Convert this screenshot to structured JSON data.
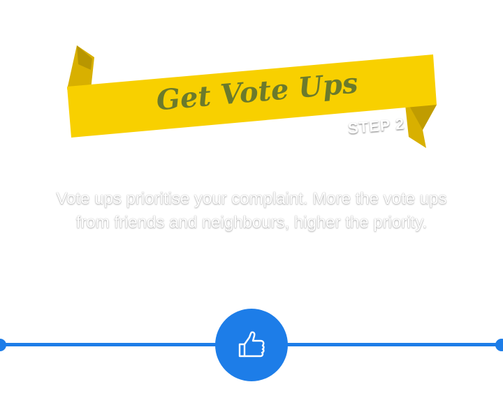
{
  "banner": {
    "title": "Get Vote Ups",
    "step": "STEP 2"
  },
  "description": "Vote ups prioritise your complaint. More the vote ups from friends and neighbours, higher the priority.",
  "timeline": {
    "icon": "thumbs-up-icon"
  },
  "colors": {
    "ribbon": "#f8d000",
    "ribbon_shadow": "#d8b000",
    "title_text": "#6b7a2c",
    "accent_blue": "#1d7de8"
  }
}
